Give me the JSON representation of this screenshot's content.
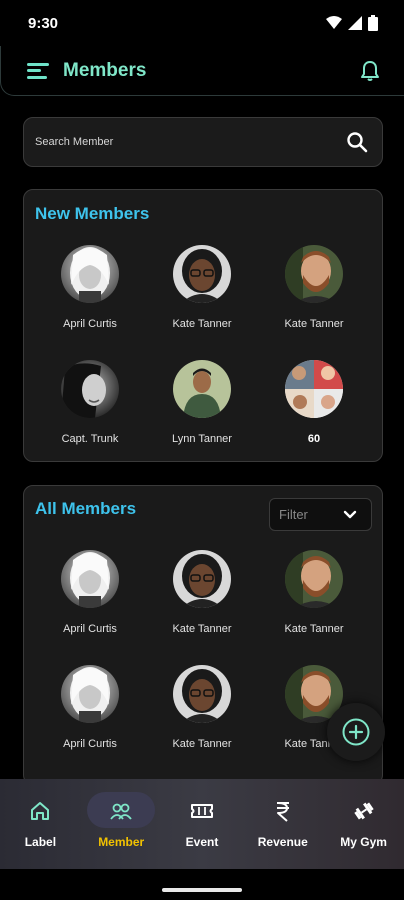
{
  "status_bar": {
    "time": "9:30"
  },
  "header": {
    "title": "Members"
  },
  "search": {
    "placeholder": "Search Member"
  },
  "new_members": {
    "title": "New Members",
    "items": [
      {
        "name": "April Curtis",
        "avatar": "blonde-woman-bw-avatar"
      },
      {
        "name": "Kate Tanner",
        "avatar": "woman-glasses-avatar"
      },
      {
        "name": "Kate Tanner",
        "avatar": "bearded-man-avatar"
      },
      {
        "name": "Capt. Trunk",
        "avatar": "woman-portrait-bw-avatar"
      },
      {
        "name": "Lynn Tanner",
        "avatar": "man-green-background-avatar"
      }
    ],
    "more": {
      "count": "60",
      "avatar": "group-collage-avatar"
    }
  },
  "all_members": {
    "title": "All Members",
    "filter": {
      "label": "Filter"
    },
    "items": [
      {
        "name": "April Curtis",
        "avatar": "blonde-woman-bw-avatar"
      },
      {
        "name": "Kate Tanner",
        "avatar": "woman-glasses-avatar"
      },
      {
        "name": "Kate Tanner",
        "avatar": "bearded-man-avatar"
      },
      {
        "name": "April Curtis",
        "avatar": "blonde-woman-bw-avatar"
      },
      {
        "name": "Kate Tanner",
        "avatar": "woman-glasses-avatar"
      },
      {
        "name": "Kate Tanner",
        "avatar": "bearded-man-avatar"
      }
    ]
  },
  "fab": {
    "icon": "plus-circle-icon"
  },
  "bottom_nav": {
    "active": "Member",
    "items": [
      {
        "label": "Label",
        "icon": "home-icon"
      },
      {
        "label": "Member",
        "icon": "members-icon"
      },
      {
        "label": "Event",
        "icon": "ticket-icon"
      },
      {
        "label": "Revenue",
        "icon": "rupee-icon"
      },
      {
        "label": "My Gym",
        "icon": "dumbbell-icon"
      }
    ]
  },
  "colors": {
    "accent_mint": "#7fe6c8",
    "section_title": "#3ec3ec",
    "active_nav": "#f2c200",
    "card_bg": "#1a1a1a",
    "page_bg": "#000000"
  }
}
